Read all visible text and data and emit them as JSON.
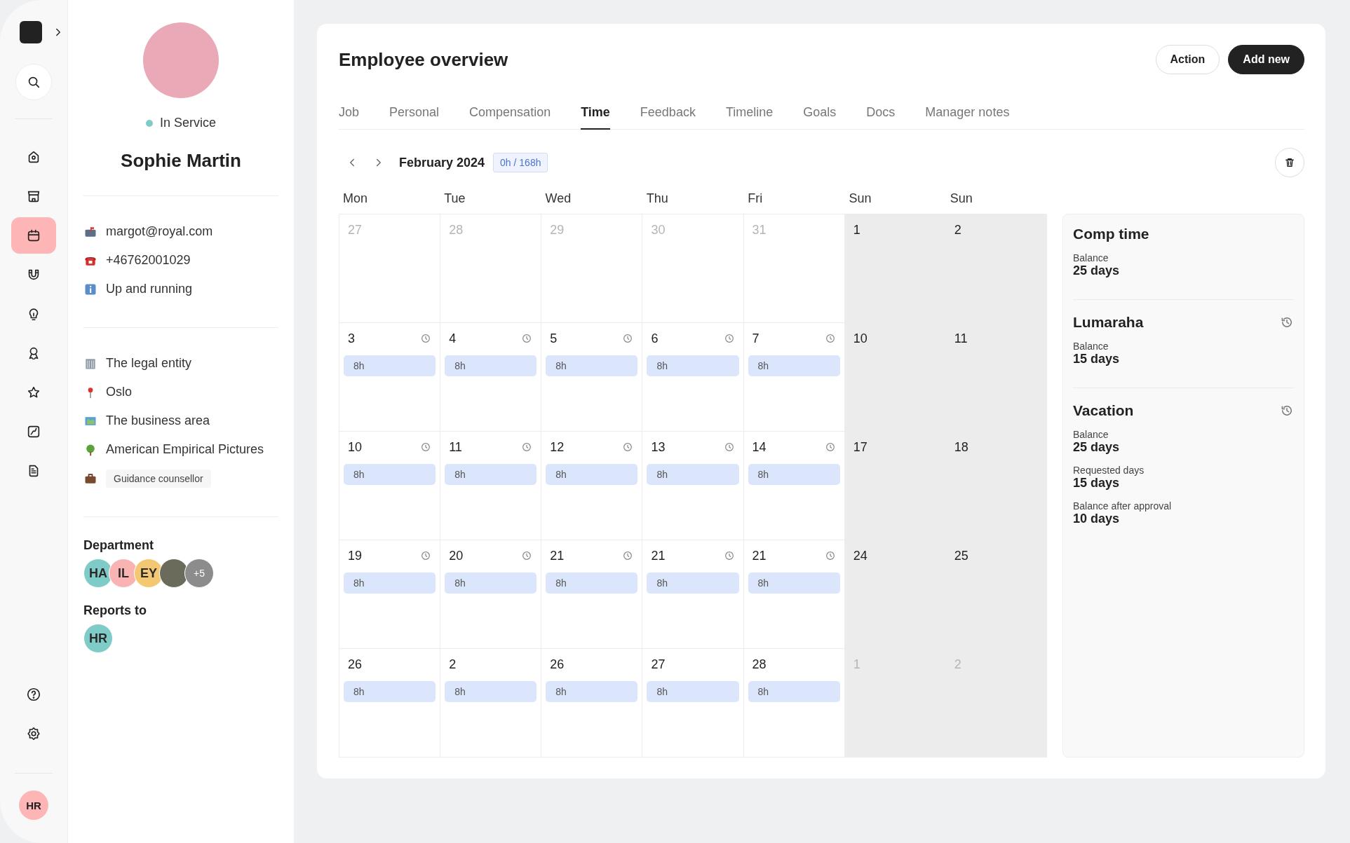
{
  "rail": {
    "items": [
      {
        "selected": false
      },
      {
        "selected": false
      },
      {
        "selected": true
      },
      {
        "selected": false
      },
      {
        "selected": false
      },
      {
        "selected": false
      },
      {
        "selected": false
      },
      {
        "selected": false
      },
      {
        "selected": false
      }
    ],
    "bottom_items": [
      {
        "selected": false
      },
      {
        "selected": false
      }
    ],
    "user_avatar": "HR"
  },
  "profile": {
    "status": {
      "text": "In Service",
      "color": "#7ecbc8"
    },
    "name": "Sophie Martin",
    "contacts": [
      "margot@royal.com",
      "+46762001029",
      "Up and running"
    ],
    "org": [
      {
        "text": "The legal entity",
        "kind": "line"
      },
      {
        "text": "Oslo",
        "kind": "line"
      },
      {
        "text": "The business area",
        "kind": "line"
      },
      {
        "text": "American Empirical Pictures",
        "kind": "line"
      },
      {
        "text": "Guidance counsellor",
        "kind": "tag"
      }
    ],
    "department": {
      "label": "Department",
      "members": [
        {
          "kind": "initials",
          "text": "HA",
          "color": "#7ecbc8"
        },
        {
          "kind": "initials",
          "text": "IL",
          "color": "#f9b3b3"
        },
        {
          "kind": "initials",
          "text": "EY",
          "color": "#f4c873"
        },
        {
          "kind": "photo"
        },
        {
          "kind": "more",
          "text": "+5",
          "color": "#8c8c8c"
        }
      ]
    },
    "reports_to": {
      "label": "Reports to",
      "members": [
        {
          "kind": "initials",
          "text": "HR",
          "color": "#7ecbc8"
        }
      ]
    }
  },
  "header": {
    "title": "Employee overview",
    "buttons": [
      {
        "label": "Action",
        "kind": "outline"
      },
      {
        "label": "Add new",
        "kind": "primary"
      }
    ]
  },
  "tabs": [
    {
      "label": "Job",
      "selected": false
    },
    {
      "label": "Personal",
      "selected": false
    },
    {
      "label": "Compensation",
      "selected": false
    },
    {
      "label": "Time",
      "selected": true
    },
    {
      "label": "Feedback",
      "selected": false
    },
    {
      "label": "Timeline",
      "selected": false
    },
    {
      "label": "Goals",
      "selected": false
    },
    {
      "label": "Docs",
      "selected": false
    },
    {
      "label": "Manager notes",
      "selected": false
    }
  ],
  "calendar": {
    "month": "February 2024",
    "hours_badge": "0h / 168h",
    "weekdays": [
      "Mon",
      "Tue",
      "Wed",
      "Thu",
      "Fri",
      "Sun",
      "Sun"
    ],
    "weeks": [
      [
        {
          "day": "27",
          "muted": true,
          "weekend": false,
          "clock": false
        },
        {
          "day": "28",
          "muted": true,
          "weekend": false,
          "clock": false
        },
        {
          "day": "29",
          "muted": true,
          "weekend": false,
          "clock": false
        },
        {
          "day": "30",
          "muted": true,
          "weekend": false,
          "clock": false
        },
        {
          "day": "31",
          "muted": true,
          "weekend": false,
          "clock": false
        },
        {
          "day": "1",
          "muted": false,
          "weekend": true,
          "clock": false
        },
        {
          "day": "2",
          "muted": false,
          "weekend": true,
          "clock": false
        }
      ],
      [
        {
          "day": "3",
          "muted": false,
          "weekend": false,
          "clock": true,
          "hours": "8h"
        },
        {
          "day": "4",
          "muted": false,
          "weekend": false,
          "clock": true,
          "hours": "8h"
        },
        {
          "day": "5",
          "muted": false,
          "weekend": false,
          "clock": true,
          "hours": "8h"
        },
        {
          "day": "6",
          "muted": false,
          "weekend": false,
          "clock": true,
          "hours": "8h"
        },
        {
          "day": "7",
          "muted": false,
          "weekend": false,
          "clock": true,
          "hours": "8h"
        },
        {
          "day": "10",
          "muted": false,
          "weekend": true,
          "clock": false
        },
        {
          "day": "11",
          "muted": false,
          "weekend": true,
          "clock": false
        }
      ],
      [
        {
          "day": "10",
          "muted": false,
          "weekend": false,
          "clock": true,
          "hours": "8h"
        },
        {
          "day": "11",
          "muted": false,
          "weekend": false,
          "clock": true,
          "hours": "8h"
        },
        {
          "day": "12",
          "muted": false,
          "weekend": false,
          "clock": true,
          "hours": "8h"
        },
        {
          "day": "13",
          "muted": false,
          "weekend": false,
          "clock": true,
          "hours": "8h"
        },
        {
          "day": "14",
          "muted": false,
          "weekend": false,
          "clock": true,
          "hours": "8h"
        },
        {
          "day": "17",
          "muted": false,
          "weekend": true,
          "clock": false
        },
        {
          "day": "18",
          "muted": false,
          "weekend": true,
          "clock": false
        }
      ],
      [
        {
          "day": "19",
          "muted": false,
          "weekend": false,
          "clock": true,
          "hours": "8h"
        },
        {
          "day": "20",
          "muted": false,
          "weekend": false,
          "clock": true,
          "hours": "8h"
        },
        {
          "day": "21",
          "muted": false,
          "weekend": false,
          "clock": true,
          "hours": "8h"
        },
        {
          "day": "21",
          "muted": false,
          "weekend": false,
          "clock": true,
          "hours": "8h"
        },
        {
          "day": "21",
          "muted": false,
          "weekend": false,
          "clock": true,
          "hours": "8h"
        },
        {
          "day": "24",
          "muted": false,
          "weekend": true,
          "clock": false
        },
        {
          "day": "25",
          "muted": false,
          "weekend": true,
          "clock": false
        }
      ],
      [
        {
          "day": "26",
          "muted": false,
          "weekend": false,
          "clock": false,
          "hours": "8h"
        },
        {
          "day": "2",
          "muted": false,
          "weekend": false,
          "clock": false,
          "hours": "8h"
        },
        {
          "day": "26",
          "muted": false,
          "weekend": false,
          "clock": false,
          "hours": "8h"
        },
        {
          "day": "27",
          "muted": false,
          "weekend": false,
          "clock": false,
          "hours": "8h"
        },
        {
          "day": "28",
          "muted": false,
          "weekend": false,
          "clock": false,
          "hours": "8h"
        },
        {
          "day": "1",
          "muted": true,
          "weekend": true,
          "clock": false
        },
        {
          "day": "2",
          "muted": true,
          "weekend": true,
          "clock": false
        }
      ]
    ]
  },
  "balances": [
    {
      "title": "Comp time",
      "history": false,
      "entries": [
        {
          "label": "Balance",
          "value": "25 days"
        }
      ]
    },
    {
      "title": "Lumaraha",
      "history": true,
      "entries": [
        {
          "label": "Balance",
          "value": "15 days"
        }
      ]
    },
    {
      "title": "Vacation",
      "history": true,
      "entries": [
        {
          "label": "Balance",
          "value": "25 days"
        },
        {
          "label": "Requested days",
          "value": "15 days"
        },
        {
          "label": "Balance after approval",
          "value": "10 days"
        }
      ]
    }
  ]
}
